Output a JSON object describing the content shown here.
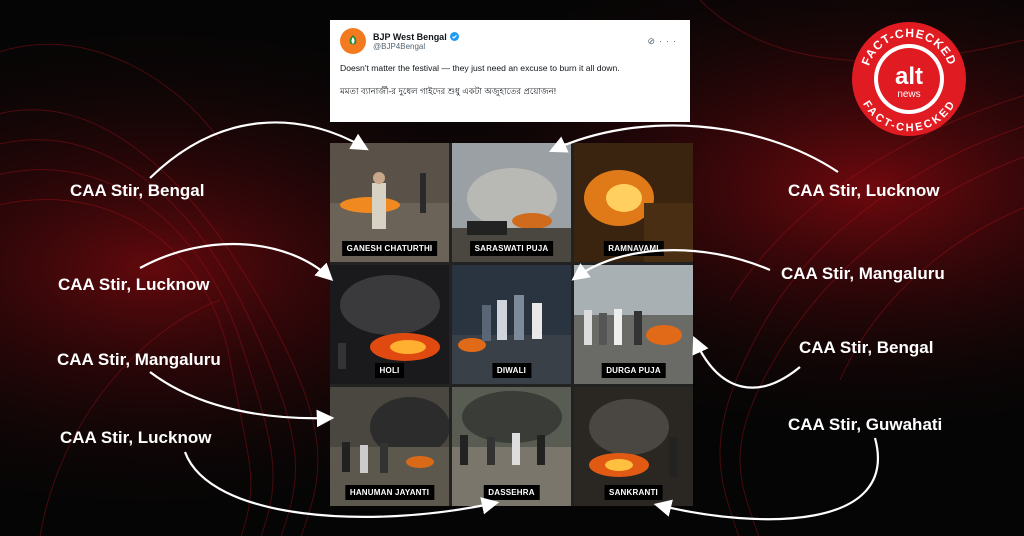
{
  "tweet": {
    "name": "BJP West Bengal",
    "handle": "@BJP4Bengal",
    "text_en": "Doesn't matter the festival — they just need an excuse to burn it all down.",
    "text_bn": "মমতা ব্যানার্জী-র দুধেল গাইদের শুধু একটা অজুহাতের প্রয়োজন!"
  },
  "tiles": [
    {
      "label": "GANESH CHATURTHI"
    },
    {
      "label": "SARASWATI PUJA"
    },
    {
      "label": "RAMNAVAMI"
    },
    {
      "label": "HOLI"
    },
    {
      "label": "DIWALI"
    },
    {
      "label": "DURGA PUJA"
    },
    {
      "label": "HANUMAN JAYANTI"
    },
    {
      "label": "DASSEHRA"
    },
    {
      "label": "SANKRANTI"
    }
  ],
  "left_labels": [
    "CAA Stir, Bengal",
    "CAA Stir, Lucknow",
    "CAA Stir, Mangaluru",
    "CAA Stir, Lucknow"
  ],
  "right_labels": [
    "CAA Stir, Lucknow",
    "CAA Stir, Mangaluru",
    "CAA Stir, Bengal",
    "CAA Stir, Guwahati"
  ],
  "badge": {
    "top_text": "FACT-CHECKED",
    "bottom_text": "FACT-CHECKED",
    "logo_main": "alt",
    "logo_sub": "news",
    "color": "#e11b22"
  },
  "colors": {
    "background": "#050505",
    "accent_red": "#c0141c"
  }
}
